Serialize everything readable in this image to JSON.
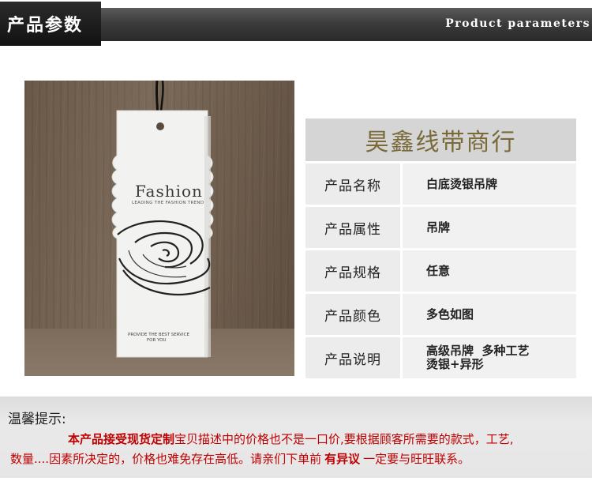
{
  "header": {
    "title_cn": "产品参数",
    "title_en": "Product parameters"
  },
  "photo": {
    "brand": "Fashion",
    "tagline": "LEADING THE FASHION TREND",
    "footer_line1": "PROVIDE THE BEST SERVICE",
    "footer_line2": "FOR YOU"
  },
  "table": {
    "shop_name": "昊鑫线带商行",
    "rows": [
      {
        "label": "产品名称",
        "value": "白底烫银吊牌"
      },
      {
        "label": "产品属性",
        "value": "吊牌"
      },
      {
        "label": "产品规格",
        "value": "任意"
      },
      {
        "label": "产品颜色",
        "value": "多色如图"
      },
      {
        "label": "产品说明",
        "value_line1": "高级吊牌  多种工艺",
        "value_line2": "烫银+异形"
      }
    ]
  },
  "notice": {
    "title": "温馨提示:",
    "line1_a": "本产品接受现货定制",
    "line1_b": "宝贝描述中的价格也不是一口价,要根据顾客所需要的款式，工艺,",
    "line2_a": "数量....因素所决定的，价格也难免存在高低。请亲们下单前",
    "line2_b": "有异议",
    "line2_c": "一定要与旺旺联系。"
  },
  "colors": {
    "banner_dark": "#2a2a2a",
    "table_header_bg": "#d5d5d5",
    "shop_name_color": "#7a6a3a",
    "notice_text": "#c00000"
  }
}
